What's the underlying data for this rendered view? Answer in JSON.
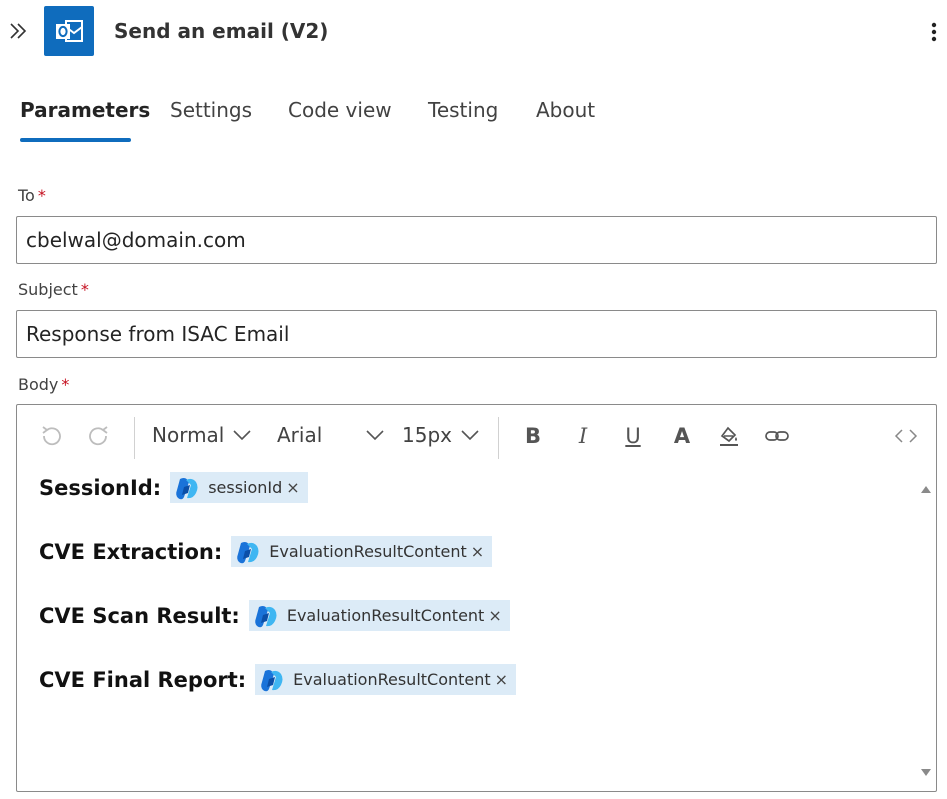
{
  "header": {
    "title": "Send an email (V2)",
    "app_icon": "outlook-icon",
    "brand_color": "#0f6cbd"
  },
  "tabs": [
    {
      "label": "Parameters",
      "active": true
    },
    {
      "label": "Settings",
      "active": false
    },
    {
      "label": "Code view",
      "active": false
    },
    {
      "label": "Testing",
      "active": false
    },
    {
      "label": "About",
      "active": false
    }
  ],
  "fields": {
    "to": {
      "label": "To",
      "required_mark": "*",
      "value": "cbelwal@domain.com"
    },
    "subject": {
      "label": "Subject",
      "required_mark": "*",
      "value": "Response from ISAC Email"
    },
    "body": {
      "label": "Body",
      "required_mark": "*"
    }
  },
  "toolbar": {
    "undo_icon": "undo-icon",
    "redo_icon": "redo-icon",
    "format": "Normal",
    "font": "Arial",
    "size": "15px",
    "bold": "B",
    "italic": "I",
    "underline": "U",
    "font_color": "A",
    "highlight_icon": "highlight-icon",
    "link_icon": "link-icon",
    "code_icon": "code-view-icon"
  },
  "body_rows": [
    {
      "label": "SessionId:",
      "token": "sessionId",
      "remove": "×"
    },
    {
      "label": "CVE Extraction:",
      "token": "EvaluationResultContent",
      "remove": "×"
    },
    {
      "label": "CVE Scan Result:",
      "token": "EvaluationResultContent",
      "remove": "×"
    },
    {
      "label": "CVE Final Report:",
      "token": "EvaluationResultContent",
      "remove": "×"
    }
  ],
  "colors": {
    "accent": "#0f6cbd",
    "required": "#c50f1f",
    "token_bg": "#dcebf7"
  }
}
